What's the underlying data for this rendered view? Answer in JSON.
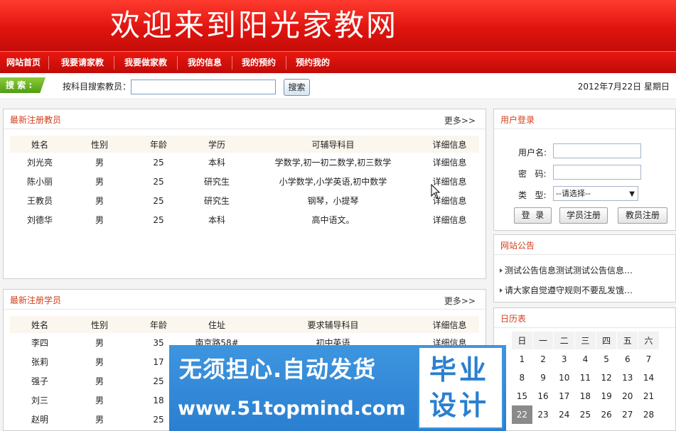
{
  "banner": {
    "title": "欢迎来到阳光家教网"
  },
  "nav": {
    "items": [
      "网站首页",
      "我要请家教",
      "我要做家教",
      "我的信息",
      "我的预约",
      "预约我的"
    ]
  },
  "search": {
    "tag": "搜 索 :",
    "label": "按科目搜索教员：",
    "input_value": "",
    "button": "搜索",
    "date": "2012年7月22日  星期日"
  },
  "teachers_panel": {
    "title": "最新注册教员",
    "more": "更多>>",
    "columns": [
      "姓名",
      "性别",
      "年龄",
      "学历",
      "可辅导科目",
      "详细信息"
    ],
    "rows": [
      [
        "刘光亮",
        "男",
        "25",
        "本科",
        "学数学,初一初二数学,初三数学",
        "详细信息"
      ],
      [
        "陈小丽",
        "男",
        "25",
        "研究生",
        "小学数学,小学英语,初中数学",
        "详细信息"
      ],
      [
        "王教员",
        "男",
        "25",
        "研究生",
        "钢琴，小提琴",
        "详细信息"
      ],
      [
        "刘德华",
        "男",
        "25",
        "本科",
        "高中语文。",
        "详细信息"
      ]
    ]
  },
  "students_panel": {
    "title": "最新注册学员",
    "more": "更多>>",
    "columns": [
      "姓名",
      "性别",
      "年龄",
      "住址",
      "要求辅导科目",
      "详细信息"
    ],
    "rows": [
      [
        "李四",
        "男",
        "35",
        "南京路58#",
        "初中英语",
        "详细信息"
      ],
      [
        "张莉",
        "男",
        "17",
        "",
        "",
        ""
      ],
      [
        "强子",
        "男",
        "25",
        "",
        "",
        ""
      ],
      [
        "刘三",
        "男",
        "18",
        "",
        "",
        ""
      ],
      [
        "赵明",
        "男",
        "25",
        "",
        "",
        ""
      ]
    ]
  },
  "login": {
    "title": "用户登录",
    "username_label": "用户名:",
    "password_label": "密   码:",
    "type_label": "类   型:",
    "type_selected": "--请选择--",
    "btn_login": "登  录",
    "btn_student": "学员注册",
    "btn_teacher": "教员注册"
  },
  "notices": {
    "title": "网站公告",
    "items": [
      "测试公告信息测试测试公告信息…",
      "请大家自觉遵守规则不要乱发饿…"
    ]
  },
  "calendar": {
    "title": "日历表",
    "weekdays": [
      "日",
      "一",
      "二",
      "三",
      "四",
      "五",
      "六"
    ],
    "weeks": [
      [
        "1",
        "2",
        "3",
        "4",
        "5",
        "6",
        "7"
      ],
      [
        "8",
        "9",
        "10",
        "11",
        "12",
        "13",
        "14"
      ],
      [
        "15",
        "16",
        "17",
        "18",
        "19",
        "20",
        "21"
      ],
      [
        "22",
        "23",
        "24",
        "25",
        "26",
        "27",
        "28"
      ]
    ],
    "today": "22"
  },
  "watermark": {
    "main": "无须担心.自动发货",
    "url": "www.51topmind.com",
    "box_line1": "毕业",
    "box_line2": "设计"
  }
}
